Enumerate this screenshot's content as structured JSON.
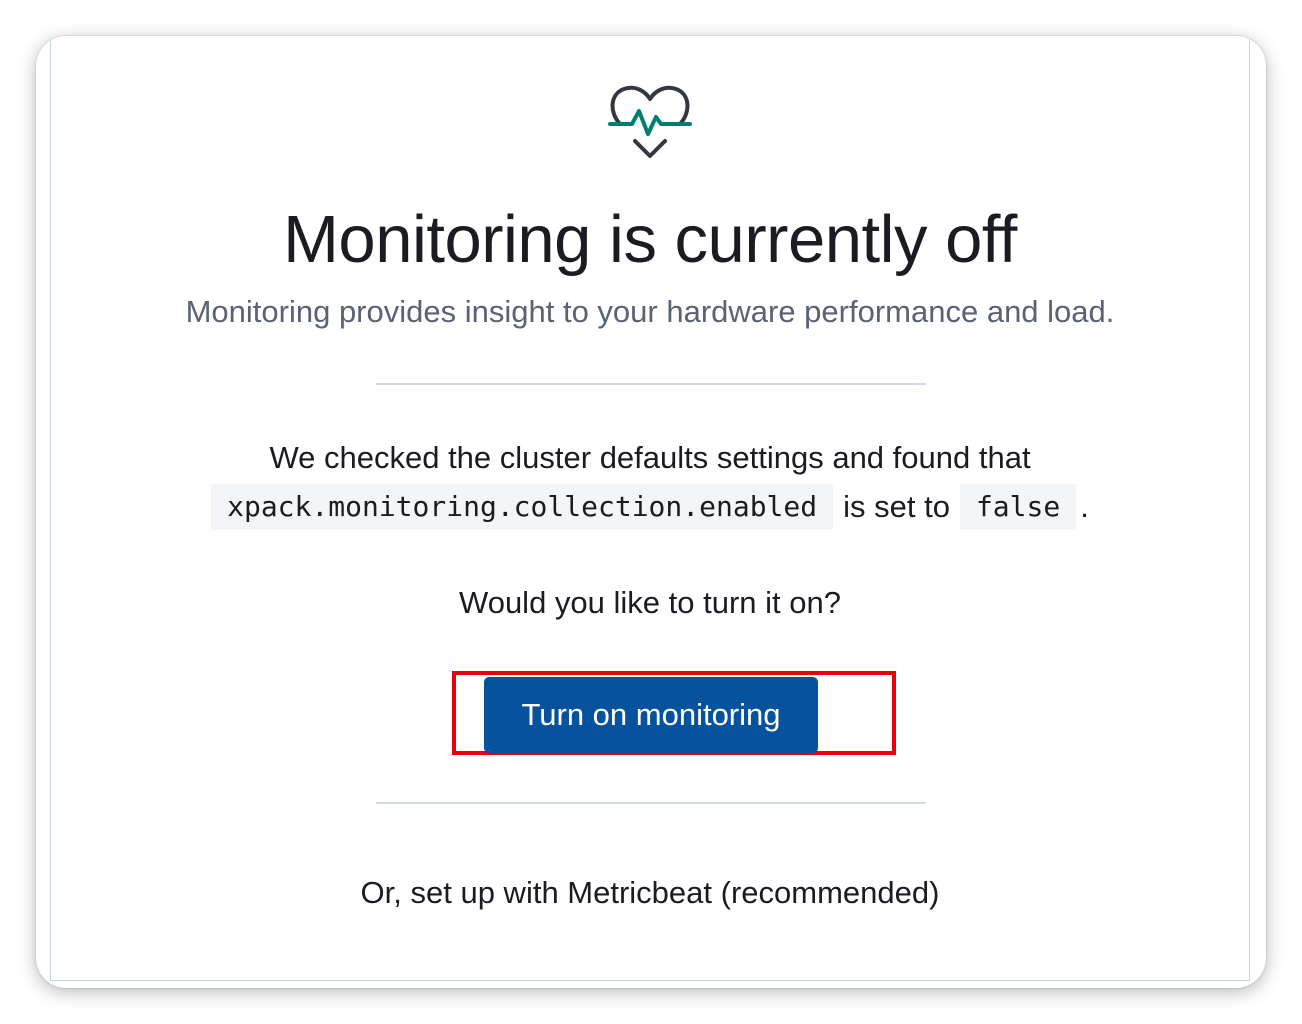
{
  "empty_state": {
    "icon": "heart-pulse-icon",
    "title": "Monitoring is currently off",
    "subtitle": "Monitoring provides insight to your hardware performance and load.",
    "description_prefix": "We checked the cluster defaults settings and found that",
    "setting_name": "xpack.monitoring.collection.enabled",
    "description_middle": "is set to",
    "setting_value": "false",
    "description_suffix": ".",
    "question": "Would you like to turn it on?",
    "primary_button_label": "Turn on monitoring",
    "metricbeat_link": "Or, set up with Metricbeat (recommended)"
  },
  "colors": {
    "button_bg": "#07529c",
    "highlight_border": "#e8000d",
    "icon_teal": "#017d73",
    "icon_dark": "#343741"
  }
}
